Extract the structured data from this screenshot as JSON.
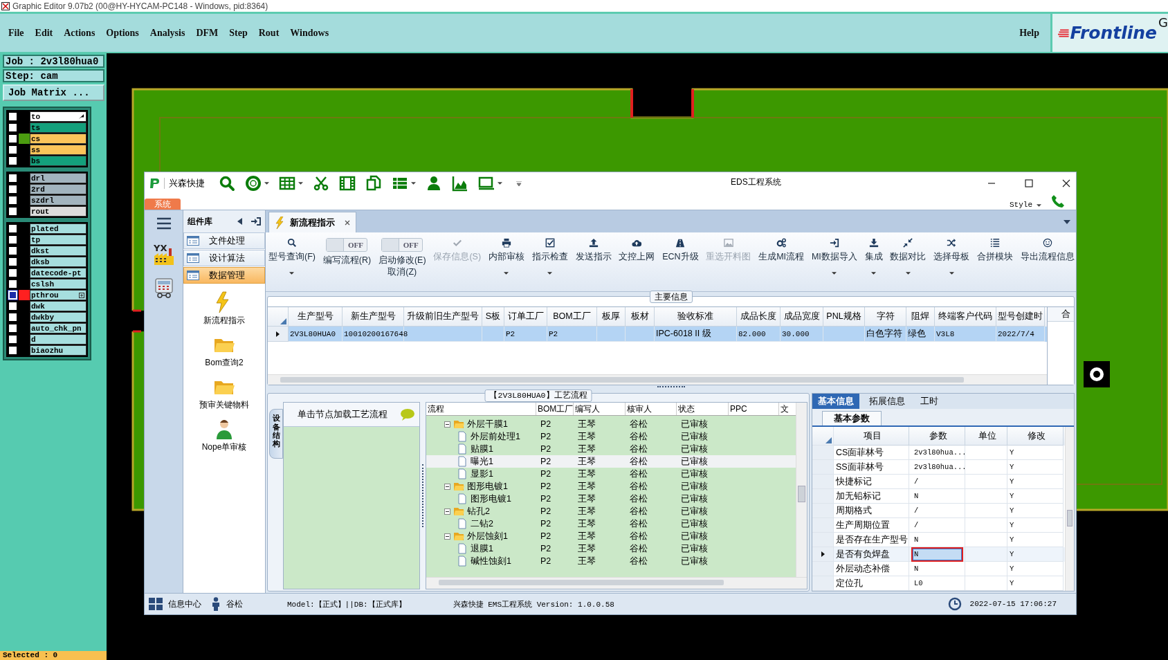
{
  "app_title": "Graphic Editor 9.07b2 (00@HY-HYCAM-PC148 - Windows, pid:8364)",
  "menu": [
    "File",
    "Edit",
    "Actions",
    "Options",
    "Analysis",
    "DFM",
    "Step",
    "Rout",
    "Windows"
  ],
  "help": "Help",
  "logo": {
    "text": "Frontline",
    "trailing": "G"
  },
  "job": "Job : 2v3l80hua0",
  "step": "Step: cam",
  "job_matrix_button": "Job Matrix ...",
  "layer_groups": [
    {
      "layers": [
        {
          "name": "to",
          "color": "#ffffff",
          "selected": false,
          "cursor": true
        },
        {
          "name": "ts",
          "color": "#14a07c",
          "selected": false
        },
        {
          "name": "cs",
          "color": "#fcc45a",
          "selected": false,
          "marker": {
            "color": "#4c9c10"
          }
        },
        {
          "name": "ss",
          "color": "#fcc45a",
          "selected": false
        },
        {
          "name": "bs",
          "color": "#14a07c",
          "selected": false
        }
      ]
    },
    {
      "layers": [
        {
          "name": "drl",
          "color": "#a2b4be",
          "selected": false
        },
        {
          "name": "2rd",
          "color": "#a2b4be",
          "selected": false
        },
        {
          "name": "szdrl",
          "color": "#a2b4be",
          "selected": false
        },
        {
          "name": "rout",
          "color": "#dcdcdc",
          "selected": false
        }
      ]
    },
    {
      "layers": [
        {
          "name": "plated",
          "color": "#a6dede",
          "selected": false
        },
        {
          "name": "tp",
          "color": "#a6dede",
          "selected": false
        },
        {
          "name": "dkst",
          "color": "#a6dede",
          "selected": false
        },
        {
          "name": "dksb",
          "color": "#a6dede",
          "selected": false
        },
        {
          "name": "datecode-pt",
          "color": "#a6dede",
          "selected": false
        },
        {
          "name": "cslsh",
          "color": "#a6dede",
          "selected": false
        },
        {
          "name": "pthrou",
          "color": "#a6dede",
          "selected": true,
          "marker": {
            "color": "#ff2020"
          },
          "expandable": true
        },
        {
          "name": "dwk",
          "color": "#a6dede",
          "selected": false
        },
        {
          "name": "dwkby",
          "color": "#a6dede",
          "selected": false
        },
        {
          "name": "auto_chk_pn",
          "color": "#a6dede",
          "selected": false
        },
        {
          "name": "d",
          "color": "#a6dede",
          "selected": false
        },
        {
          "name": "biaozhu",
          "color": "#a6dede",
          "selected": false
        }
      ]
    }
  ],
  "selected_count": "Selected : 0",
  "eds": {
    "title": "EDS工程系统",
    "quick_label": "兴森快捷",
    "system_tab": "系统",
    "style_label": "Style",
    "nav_logo_text": "YX",
    "library": {
      "title": "组件库",
      "groups": [
        {
          "label": "文件处理",
          "selected": false
        },
        {
          "label": "设计算法",
          "selected": false
        },
        {
          "label": "数据管理",
          "selected": true
        }
      ],
      "items": [
        {
          "label": "新流程指示",
          "kind": "flash"
        },
        {
          "label": "Bom查询2",
          "kind": "folder"
        },
        {
          "label": "预审关键物料",
          "kind": "folder"
        },
        {
          "label": "Nope单审核",
          "kind": "person"
        }
      ]
    },
    "doc_tab": "新流程指示",
    "ribbon": [
      {
        "kind": "button",
        "label": "型号查询(F)",
        "dropdown": true,
        "disabled": false
      },
      {
        "kind": "toggle",
        "label": "编写流程(R)",
        "toggle_text": "OFF",
        "on": false
      },
      {
        "kind": "toggle",
        "label": "启动修改(E)\n取消(Z)",
        "toggle_text": "OFF",
        "on": false
      },
      {
        "kind": "button",
        "label": "保存信息(S)",
        "dropdown": false,
        "disabled": true
      },
      {
        "kind": "button",
        "label": "内部审核",
        "dropdown": true,
        "disabled": false
      },
      {
        "kind": "button",
        "label": "指示检查",
        "dropdown": true,
        "disabled": false
      },
      {
        "kind": "button",
        "label": "发送指示",
        "dropdown": false,
        "disabled": false
      },
      {
        "kind": "button",
        "label": "文控上网",
        "dropdown": false,
        "disabled": false
      },
      {
        "kind": "button",
        "label": "ECN升级",
        "dropdown": false,
        "disabled": false
      },
      {
        "kind": "button",
        "label": "重选开料图",
        "dropdown": false,
        "disabled": true
      },
      {
        "kind": "button",
        "label": "生成MI流程",
        "dropdown": false,
        "disabled": false
      },
      {
        "kind": "button",
        "label": "MI数据导入",
        "dropdown": true,
        "disabled": false
      },
      {
        "kind": "button",
        "label": "集成",
        "dropdown": true,
        "disabled": false
      },
      {
        "kind": "button",
        "label": "数据对比",
        "dropdown": true,
        "disabled": false
      },
      {
        "kind": "button",
        "label": "选择母板",
        "dropdown": true,
        "disabled": false
      },
      {
        "kind": "button",
        "label": "合拼模块",
        "dropdown": false,
        "disabled": false
      },
      {
        "kind": "button",
        "label": "导出流程信息",
        "dropdown": false,
        "disabled": false
      }
    ],
    "main_info": {
      "title": "主要信息",
      "columns": [
        "生产型号",
        "新生产型号",
        "升级前旧生产型号",
        "S板",
        "订单工厂",
        "BOM工厂",
        "板厚",
        "板材",
        "验收标准",
        "成品长度",
        "成品宽度",
        "PNL规格",
        "字符",
        "阻焊",
        "终端客户代码",
        "型号创建时"
      ],
      "rows": [
        {
          "selected": true,
          "cells": [
            "2V3L80HUA0",
            "10010200167648",
            null,
            null,
            "P2",
            "P2",
            null,
            null,
            "IPC-6018 II 级",
            "82.000",
            "30.000",
            null,
            "白色字符",
            "绿色",
            "V3L8",
            "2022/7/4"
          ]
        }
      ],
      "side_column": "合"
    },
    "process": {
      "title": "【2V3L80HUA0】工艺流程",
      "side_tab": "设备结构",
      "hint": "单击节点加载工艺流程",
      "columns": [
        "流程",
        "BOM工厂",
        "编写人",
        "核审人",
        "状态",
        "PPC",
        "文"
      ],
      "tree": [
        {
          "label": "外层干膜1",
          "kind": "folder",
          "expanded": true,
          "selected": false,
          "bom": "P2",
          "author": "王琴",
          "reviewer": "谷松",
          "status": "已审核",
          "children": [
            {
              "label": "外层前处理1",
              "kind": "file",
              "selected": false,
              "bom": "P2",
              "author": "王琴",
              "reviewer": "谷松",
              "status": "已审核"
            },
            {
              "label": "贴膜1",
              "kind": "file",
              "selected": false,
              "bom": "P2",
              "author": "王琴",
              "reviewer": "谷松",
              "status": "已审核"
            },
            {
              "label": "曝光1",
              "kind": "file",
              "selected": true,
              "bom": "P2",
              "author": "王琴",
              "reviewer": "谷松",
              "status": "已审核"
            },
            {
              "label": "显影1",
              "kind": "file",
              "selected": false,
              "bom": "P2",
              "author": "王琴",
              "reviewer": "谷松",
              "status": "已审核"
            }
          ]
        },
        {
          "label": "图形电镀1",
          "kind": "folder",
          "expanded": true,
          "selected": false,
          "bom": "P2",
          "author": "王琴",
          "reviewer": "谷松",
          "status": "已审核",
          "children": [
            {
              "label": "图形电镀1",
              "kind": "file",
              "selected": false,
              "bom": "P2",
              "author": "王琴",
              "reviewer": "谷松",
              "status": "已审核"
            }
          ]
        },
        {
          "label": "钻孔2",
          "kind": "folder",
          "expanded": true,
          "selected": false,
          "bom": "P2",
          "author": "王琴",
          "reviewer": "谷松",
          "status": "已审核",
          "children": [
            {
              "label": "二钻2",
              "kind": "file",
              "selected": false,
              "bom": "P2",
              "author": "王琴",
              "reviewer": "谷松",
              "status": "已审核"
            }
          ]
        },
        {
          "label": "外层蚀刻1",
          "kind": "folder",
          "expanded": true,
          "selected": false,
          "bom": "P2",
          "author": "王琴",
          "reviewer": "谷松",
          "status": "已审核",
          "children": [
            {
              "label": "退膜1",
              "kind": "file",
              "selected": false,
              "bom": "P2",
              "author": "王琴",
              "reviewer": "谷松",
              "status": "已审核"
            },
            {
              "label": "碱性蚀刻1",
              "kind": "file",
              "selected": false,
              "bom": "P2",
              "author": "王琴",
              "reviewer": "谷松",
              "status": "已审核"
            }
          ]
        }
      ]
    },
    "details": {
      "tabs": [
        {
          "label": "基本信息",
          "selected": true
        },
        {
          "label": "拓展信息",
          "selected": false
        },
        {
          "label": "工时",
          "selected": false
        }
      ],
      "sub_tab": "基本参数",
      "columns": [
        "项目",
        "参数",
        "单位",
        "修改"
      ],
      "rows": [
        {
          "item": "CS面菲林号",
          "param": "2v3l80hua...",
          "modified": "Y",
          "selected": false,
          "outlined": false
        },
        {
          "item": "SS面菲林号",
          "param": "2v3l80hua...",
          "modified": "Y",
          "selected": false,
          "outlined": false
        },
        {
          "item": "快捷标记",
          "param": "/",
          "modified": "Y",
          "selected": false,
          "outlined": false
        },
        {
          "item": "加无铅标记",
          "param": "N",
          "modified": "Y",
          "selected": false,
          "outlined": false
        },
        {
          "item": "周期格式",
          "param": "/",
          "modified": "Y",
          "selected": false,
          "outlined": false
        },
        {
          "item": "生产周期位置",
          "param": "/",
          "modified": "Y",
          "selected": false,
          "outlined": false
        },
        {
          "item": "是否存在生产型号",
          "param": "N",
          "modified": "Y",
          "selected": false,
          "outlined": false
        },
        {
          "item": "是否有负焊盘",
          "param": "N",
          "modified": "Y",
          "selected": true,
          "outlined": true
        },
        {
          "item": "外层动态补偿",
          "param": "N",
          "modified": "Y",
          "selected": false,
          "outlined": false
        },
        {
          "item": "定位孔",
          "param": "L0",
          "modified": "Y",
          "selected": false,
          "outlined": false
        }
      ]
    },
    "status": {
      "info_center": "信息中心",
      "user": "谷松",
      "model": "Model:【正式】||DB:【正式库】",
      "version": "兴森快捷 EMS工程系统 Version: 1.0.0.58",
      "datetime": "2022-07-15 17:06:27"
    }
  }
}
